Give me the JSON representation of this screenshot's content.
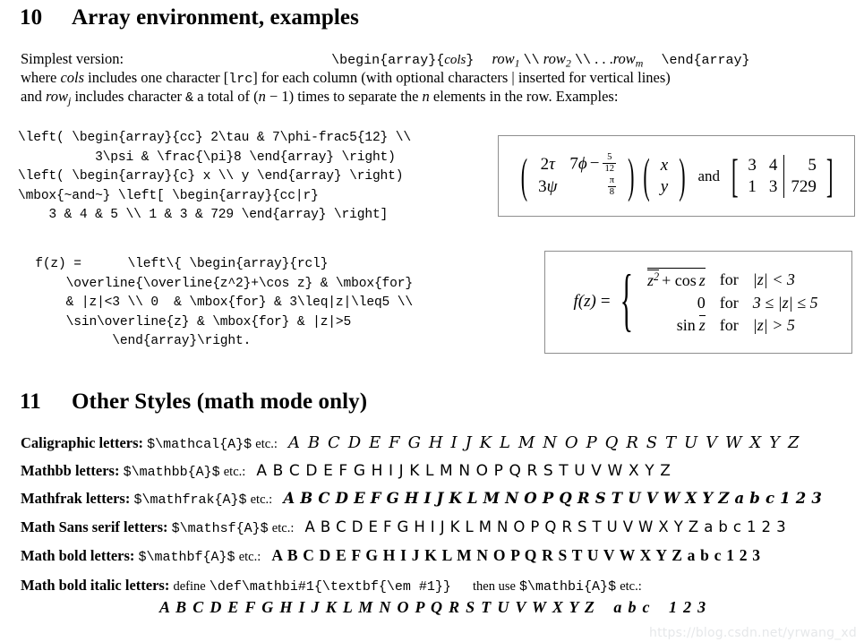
{
  "document": {
    "watermark": "https://blog.csdn.net/yrwang_xd"
  },
  "section10": {
    "number": "10",
    "title": "Array environment, examples",
    "intro": {
      "line1_left": "Simplest version:",
      "line1_code_begin": "\\begin{array}{",
      "line1_cols": "cols",
      "line1_code_brace": "}",
      "line1_rows": "row",
      "line1_rows_sub1": "1",
      "line1_sep1": "\\\\",
      "line1_rows2": "row",
      "line1_rows_sub2": "2",
      "line1_sep2": "\\\\",
      "line1_dots": ". . .",
      "line1_rowm": "row",
      "line1_rowm_sub": "m",
      "line1_code_end": "\\end{array}",
      "line2_a": "where ",
      "line2_cols": "cols",
      "line2_b": " includes one character [",
      "line2_lrc": "lrc",
      "line2_c": "] for each column (with optional characters | inserted for vertical lines)",
      "line3_a": "and ",
      "line3_row": "row",
      "line3_row_sub": "j",
      "line3_b": " includes character ",
      "line3_amp": "&",
      "line3_c": " a total of (",
      "line3_n": "n",
      "line3_d": " − 1) times to separate the ",
      "line3_n2": "n",
      "line3_e": " elements in the row.  Examples:"
    },
    "code1": "\\left( \\begin{array}{cc} 2\\tau & 7\\phi-frac5{12} \\\\\n          3\\psi & \\frac{\\pi}8 \\end{array} \\right)\n\\left( \\begin{array}{c} x \\\\ y \\end{array} \\right)\n\\mbox{~and~} \\left[ \\begin{array}{cc|r}\n    3 & 4 & 5 \\\\ 1 & 3 & 729 \\end{array} \\right]",
    "code2": "  f(z) =      \\left\\{ \\begin{array}{rcl}\n      \\overline{\\overline{z^2}+\\cos z} & \\mbox{for}\n      & |z|<3 \\\\ 0  & \\mbox{for} & 3\\leq|z|\\leq5 \\\\\n      \\sin\\overline{z} & \\mbox{for} & |z|>5\n            \\end{array}\\right.",
    "rendered1": {
      "matrix_a": [
        [
          "2τ",
          "7ϕ − 5/12"
        ],
        [
          "3ψ",
          "π/8"
        ]
      ],
      "matrix_a_cells": {
        "r1c1_coef": "2",
        "r1c1_sym": "τ",
        "r1c2_coef": "7",
        "r1c2_sym": "ϕ",
        "r1c2_minus": "−",
        "r1c2_frac_n": "5",
        "r1c2_frac_d": "12",
        "r2c1_coef": "3",
        "r2c1_sym": "ψ",
        "r2c2_frac_n": "π",
        "r2c2_frac_d": "8"
      },
      "vector_b": [
        "x",
        "y"
      ],
      "and_word": "and",
      "matrix_c": [
        [
          "3",
          "4",
          "5"
        ],
        [
          "1",
          "3",
          "729"
        ]
      ],
      "left_paren": "(",
      "right_paren": ")",
      "left_bracket": "[",
      "right_bracket": "]"
    },
    "rendered2": {
      "lhs": "f(z) =",
      "lhs_f": "f",
      "lhs_z": "(z)",
      "lhs_eq": "=",
      "brace": "{",
      "rows": [
        {
          "value": "z² + cos z",
          "for": "for",
          "cond": "|z| < 3"
        },
        {
          "value": "0",
          "for": "for",
          "cond": "3 ≤ |z| ≤ 5"
        },
        {
          "value": "sin z̅",
          "for": "for",
          "cond": "|z| > 5"
        }
      ],
      "row1_base": "z",
      "row1_exp": "2",
      "row1_rest": "+ cos",
      "row1_z": "z",
      "row2_value": "0",
      "row3_sin": "sin",
      "row3_z": "z",
      "cond1": "|z| < 3",
      "cond2": "3 ≤ |z| ≤ 5",
      "cond3": "|z| > 5"
    }
  },
  "section11": {
    "number": "11",
    "title": "Other Styles (math mode only)",
    "rows": [
      {
        "label": "Caligraphic letters",
        "colon": ":",
        "command": "$\\mathcal{A}$",
        "etc": "etc.:",
        "sample": "A B C D E F G H I J K L M N O P Q R S T U V W X Y Z",
        "style": "cal"
      },
      {
        "label": "Mathbb letters",
        "colon": ":",
        "command": "$\\mathbb{A}$",
        "etc": "etc.:",
        "sample": "A B C D E F G H I J K L M N O P Q R S T U V W X Y Z",
        "style": "bb"
      },
      {
        "label": "Mathfrak letters",
        "colon": ":",
        "command": "$\\mathfrak{A}$",
        "etc": "etc.:",
        "sample": "A B C D E F G H I J K L M N O P Q R S T U V W X Y Z a b c 1 2 3",
        "style": "frak"
      },
      {
        "label": "Math Sans serif letters",
        "colon": ":",
        "command": "$\\mathsf{A}$",
        "etc": "etc.:",
        "sample": "A B C D E F G H I J K L M N O P Q R S T U V W X Y Z a b c 1 2 3",
        "style": "sf"
      },
      {
        "label": "Math bold letters",
        "colon": ":",
        "command": "$\\mathbf{A}$",
        "etc": "etc.:",
        "sample": "A B C D E F G H I J K L M N O P Q R S T U V W X Y Z a b c 1 2 3",
        "style": "bf"
      }
    ],
    "bolditalic": {
      "label": "Math bold italic letters",
      "colon": ":",
      "define_word": "define",
      "command_def": "\\def\\mathbi#1{\\textbf{\\em #1}}",
      "then_use": "then use",
      "command_use": "$\\mathbi{A}$",
      "etc": "etc.:",
      "sample": "A B C D E F G H I J K L M N O P Q R S T U V W X Y Z",
      "sample_abc": "a b c",
      "sample_123": "1 2 3"
    }
  }
}
